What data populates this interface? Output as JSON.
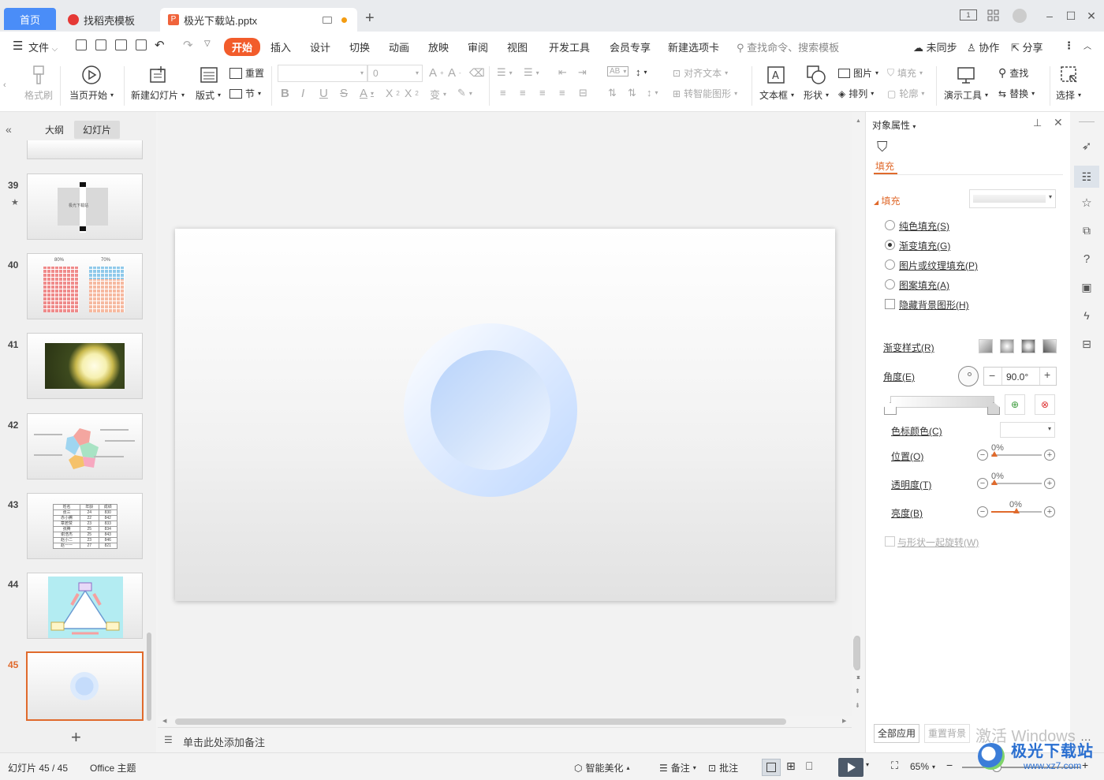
{
  "tabs": {
    "home": "首页",
    "daoke": "找稻壳模板",
    "file": "极光下载站.pptx"
  },
  "menu": {
    "file": "文件",
    "start": "开始",
    "insert": "插入",
    "design": "设计",
    "transition": "切换",
    "animation": "动画",
    "slideshow": "放映",
    "review": "审阅",
    "view": "视图",
    "devtools": "开发工具",
    "member": "会员专享",
    "newtab": "新建选项卡",
    "search_placeholder": "查找命令、搜索模板",
    "sync": "未同步",
    "collab": "协作",
    "share": "分享"
  },
  "ribbon": {
    "format_painter": "格式刷",
    "from_current": "当页开始",
    "new_slide": "新建幻灯片",
    "layout": "版式",
    "reset": "重置",
    "section": "节",
    "font_size": "0",
    "align_text": "对齐文本",
    "smart_art": "转智能图形",
    "textbox": "文本框",
    "shape": "形状",
    "picture": "图片",
    "arrange": "排列",
    "fill": "填充",
    "outline": "轮廓",
    "present_tools": "演示工具",
    "find": "查找",
    "replace": "替换",
    "select": "选择"
  },
  "left_panel": {
    "tab_outline": "大纲",
    "tab_slides": "幻灯片",
    "slides": [
      {
        "num": "39",
        "title": "极光下载站"
      },
      {
        "num": "40",
        "label_a": "80%",
        "label_b": "70%"
      },
      {
        "num": "41"
      },
      {
        "num": "42"
      },
      {
        "num": "43",
        "table": [
          [
            "姓名",
            "年龄",
            "成绩"
          ],
          [
            "张三",
            "24",
            "830"
          ],
          [
            "赤小腾",
            "22",
            "842"
          ],
          [
            "章若赞",
            "23",
            "833"
          ],
          [
            "张腾",
            "25",
            "834"
          ],
          [
            "谢浩杰",
            "25",
            "843"
          ],
          [
            "赵小二",
            "23",
            "846"
          ],
          [
            "赵一一",
            "27",
            "821"
          ]
        ]
      },
      {
        "num": "44"
      },
      {
        "num": "45"
      }
    ]
  },
  "notes_placeholder": "单击此处添加备注",
  "right_panel": {
    "title": "对象属性",
    "fill_tab": "填充",
    "section_fill": "填充",
    "opt_solid": "纯色填充(S)",
    "opt_gradient": "渐变填充(G)",
    "opt_picture": "图片或纹理填充(P)",
    "opt_pattern": "图案填充(A)",
    "opt_hide_bg": "隐藏背景图形(H)",
    "grad_style": "渐变样式(R)",
    "angle": "角度(E)",
    "angle_value": "90.0°",
    "stop_color": "色标颜色(C)",
    "position": "位置(O)",
    "position_value": "0%",
    "transparency": "透明度(T)",
    "transparency_value": "0%",
    "brightness": "亮度(B)",
    "brightness_value": "0%",
    "rotate_with": "与形状一起旋转(W)",
    "apply_all": "全部应用",
    "reset_bg": "重置背景"
  },
  "status": {
    "slide_count": "幻灯片 45 / 45",
    "theme": "Office 主题",
    "beautify": "智能美化",
    "notes": "备注",
    "comments": "批注",
    "zoom": "65%"
  },
  "watermark": {
    "activate": "激活 Windows",
    "site": "极光下载站",
    "url": "www.xz7.com"
  },
  "colors": {
    "accent": "#f25c2b",
    "home_tab": "#4a8df8",
    "selected_border": "#e06a2c"
  }
}
